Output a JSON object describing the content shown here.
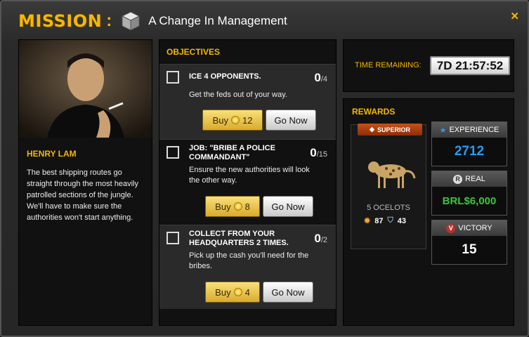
{
  "header": {
    "title": "MISSION",
    "colon": ":",
    "mission_name": "A Change In Management",
    "close_label": "✕"
  },
  "npc": {
    "name": "HENRY LAM",
    "description": "The best shipping routes go straight through the most heavily patrolled sections of the jungle. We'll have to make sure the authorities won't start anything."
  },
  "objectives": {
    "title": "OBJECTIVES",
    "items": [
      {
        "title": "ICE 4 OPPONENTS.",
        "description": "Get the feds out of your way.",
        "count": "0",
        "total": "/4",
        "buy_label": "Buy",
        "buy_cost": "12",
        "go_label": "Go Now"
      },
      {
        "title": "JOB: \"BRIBE A POLICE COMMANDANT\"",
        "description": "Ensure the new authorities will look the other way.",
        "count": "0",
        "total": "/15",
        "buy_label": "Buy",
        "buy_cost": "8",
        "go_label": "Go Now"
      },
      {
        "title": "COLLECT FROM YOUR HEADQUARTERS 2 TIMES.",
        "description": "Pick up the cash you'll need for the bribes.",
        "count": "0",
        "total": "/2",
        "buy_label": "Buy",
        "buy_cost": "4",
        "go_label": "Go Now"
      }
    ]
  },
  "timer": {
    "label": "TIME REMAINING:",
    "value": "7D 21:57:52"
  },
  "rewards": {
    "title": "REWARDS",
    "unit": {
      "badge": "SUPERIOR",
      "name": "5 OCELOTS",
      "attack": "87",
      "defense": "43"
    },
    "experience": {
      "label": "EXPERIENCE",
      "value": "2712",
      "color": "#2a9af0"
    },
    "real": {
      "label": "REAL",
      "value": "BRL$6,000",
      "color": "#3ec23e"
    },
    "victory": {
      "label": "VICTORY",
      "value": "15",
      "color": "#ffffff"
    }
  },
  "colors": {
    "accent": "#f5b800",
    "panel": "#111111",
    "buy": "#e8c24a"
  }
}
